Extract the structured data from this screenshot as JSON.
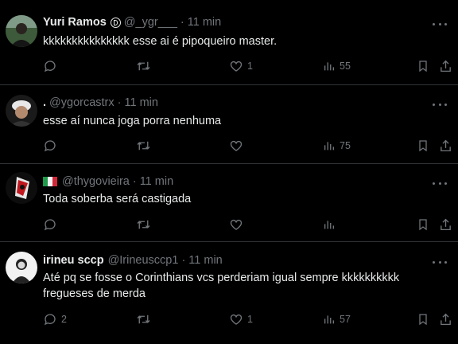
{
  "colors": {
    "background": "#000000",
    "text": "#e7e9ea",
    "muted": "#71767b",
    "border": "#2f3336"
  },
  "tweets": [
    {
      "name": "Yuri Ramos",
      "badge": "verified-icon",
      "handle": "@_ygr___",
      "sep": "·",
      "time": "11 min",
      "text": "kkkkkkkkkkkkkkk esse ai é pipoqueiro master.",
      "counts": {
        "reply": "",
        "retweet": "",
        "like": "1",
        "views": "55"
      }
    },
    {
      "name": ".",
      "handle": "@ygorcastrx",
      "sep": "·",
      "time": "11 min",
      "text": "esse aí nunca joga porra nenhuma",
      "counts": {
        "reply": "",
        "retweet": "",
        "like": "",
        "views": "75"
      }
    },
    {
      "name": "",
      "flag": "italy-flag",
      "handle": "@thygovieira",
      "sep": "·",
      "time": "11 min",
      "text": "Toda soberba será castigada",
      "counts": {
        "reply": "",
        "retweet": "",
        "like": "",
        "views": ""
      }
    },
    {
      "name": "irineu sccp",
      "handle": "@Irineusccp1",
      "sep": "·",
      "time": "11 min",
      "text": "Até pq se fosse o Corinthians vcs perderiam igual sempre kkkkkkkkkk fregueses de merda",
      "counts": {
        "reply": "2",
        "retweet": "",
        "like": "1",
        "views": "57"
      }
    }
  ]
}
